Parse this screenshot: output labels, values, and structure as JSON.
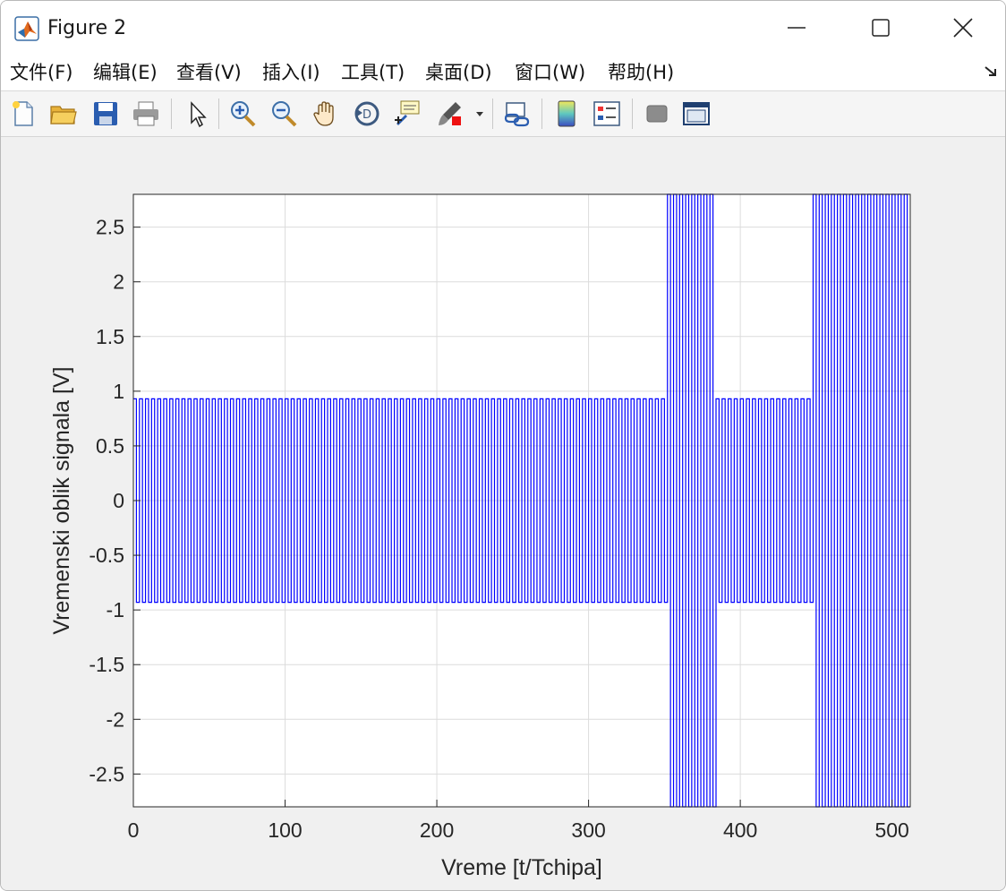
{
  "window": {
    "title": "Figure 2"
  },
  "menu": {
    "items": [
      "文件(F)",
      "编辑(E)",
      "查看(V)",
      "插入(I)",
      "工具(T)",
      "桌面(D)",
      "窗口(W)",
      "帮助(H)"
    ]
  },
  "toolbar": {
    "icons": [
      "new-figure-icon",
      "open-folder-icon",
      "save-icon",
      "print-icon",
      "pointer-icon",
      "zoom-in-icon",
      "zoom-out-icon",
      "pan-hand-icon",
      "rotate-3d-icon",
      "data-cursor-icon",
      "brush-icon",
      "brush-dropdown-icon",
      "link-plot-icon",
      "colorbar-icon",
      "legend-icon",
      "hide-plot-tools-icon",
      "show-plot-tools-icon"
    ]
  },
  "chart_data": {
    "type": "line",
    "title": "",
    "xlabel": "Vreme [t/Tchipa]",
    "ylabel": "Vremenski oblik signala [V]",
    "xlim": [
      0,
      512
    ],
    "ylim": [
      -2.8,
      2.8
    ],
    "xticks": [
      0,
      100,
      200,
      300,
      400,
      500
    ],
    "yticks": [
      -2.5,
      -2,
      -1.5,
      -1,
      -0.5,
      0,
      0.5,
      1,
      1.5,
      2,
      2.5
    ],
    "grid": true,
    "line_color": "#0000ff",
    "series": [
      {
        "description_levels": "square wave ±0.93 V alternating every chip",
        "segments": [
          {
            "x_start": 0,
            "x_end": 352,
            "amplitude": 0.93
          },
          {
            "x_start": 352,
            "x_end": 384,
            "amplitude": 2.8
          },
          {
            "x_start": 384,
            "x_end": 448,
            "amplitude": 0.93
          },
          {
            "x_start": 448,
            "x_end": 512,
            "amplitude": 2.8
          }
        ],
        "period": 4
      }
    ]
  }
}
